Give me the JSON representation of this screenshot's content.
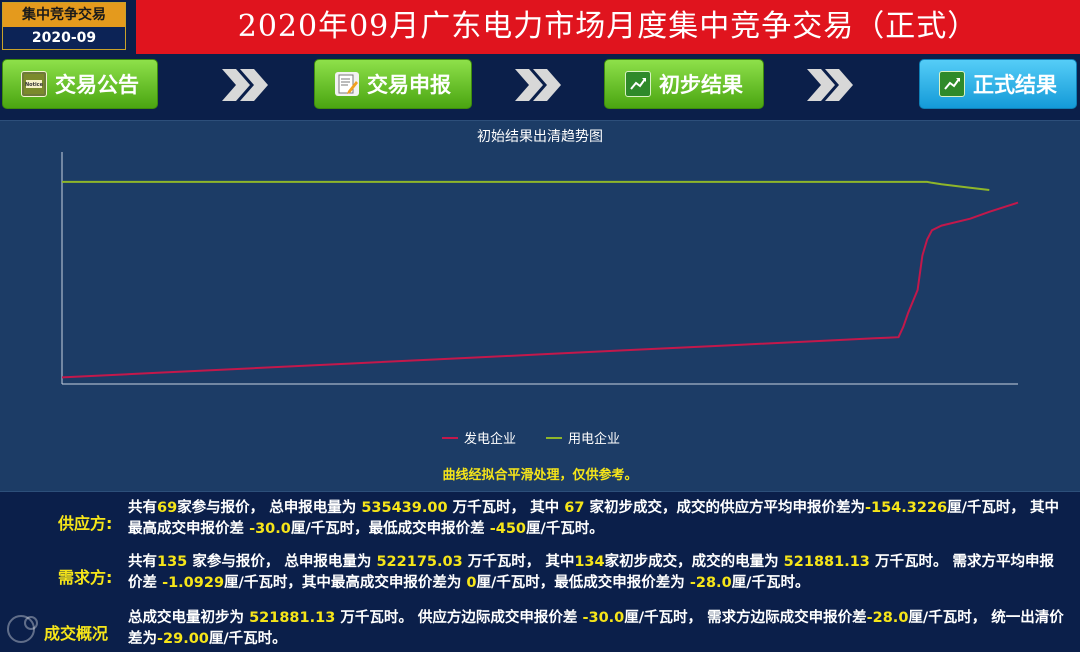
{
  "header": {
    "badge_label": "集中竞争交易",
    "badge_period": "2020-09",
    "title": "2020年09月广东电力市场月度集中竞争交易（正式）"
  },
  "nav": {
    "steps": [
      {
        "label": "交易公告",
        "icon": "notice-icon",
        "style": "green"
      },
      {
        "label": "交易申报",
        "icon": "edit-document-icon",
        "style": "green"
      },
      {
        "label": "初步结果",
        "icon": "result-icon",
        "style": "green"
      },
      {
        "label": "正式结果",
        "icon": "result-icon",
        "style": "blue"
      }
    ],
    "separator_icon": "double-chevron-right-icon"
  },
  "chart": {
    "title": "初始结果出清趋势图",
    "note": "曲线经拟合平滑处理，仅供参考。",
    "legend": [
      {
        "name": "发电企业",
        "color": "#c2184b"
      },
      {
        "name": "用电企业",
        "color": "#8fb62a"
      }
    ]
  },
  "chart_data": {
    "type": "line",
    "title": "初始结果出清趋势图",
    "xlabel": "",
    "ylabel": "",
    "grid": false,
    "legend_position": "bottom",
    "x": [
      0,
      10,
      20,
      30,
      40,
      50,
      60,
      70,
      80,
      85,
      87.5,
      88,
      88.5,
      89.5,
      90,
      90.5,
      91,
      92,
      95,
      97,
      100
    ],
    "series": [
      {
        "name": "发电企业",
        "color": "#c2184b",
        "values": [
          2,
          4,
          6,
          8,
          10,
          12,
          14,
          16,
          18,
          19,
          19.5,
          24,
          30,
          40,
          55,
          62,
          66,
          68,
          71,
          74,
          78
        ]
      },
      {
        "name": "用电企业",
        "color": "#8fb62a",
        "values": [
          87,
          87,
          87,
          87,
          87,
          87,
          87,
          87,
          87,
          87,
          87,
          87,
          87,
          87,
          87,
          87,
          86.6,
          86,
          84.5,
          83.5,
          null
        ]
      }
    ],
    "ylim": [
      0,
      100
    ],
    "xlim": [
      0,
      100
    ]
  },
  "summary": {
    "supply": {
      "label": "供应方:",
      "t1": "共有",
      "bidders": "69",
      "t2": "家参与报价，  总申报电量为",
      "total_volume": "535439.00",
      "t3": "万千瓦时，  其中",
      "matched": "67",
      "t4": "家初步成交，成交的供应方平均申报价差为",
      "avg_spread": "-154.3226",
      "t5": "厘/千瓦时，  其中最高成交申报价差",
      "max_spread": "-30.0",
      "t6": "厘/千瓦时，最低成交申报价差",
      "min_spread": "-450",
      "t7": "厘/千瓦时。"
    },
    "demand": {
      "label": "需求方:",
      "t1": "共有",
      "bidders": "135",
      "t2": "家参与报价，  总申报电量为",
      "total_volume": "522175.03",
      "t3": "万千瓦时，  其中",
      "matched": "134",
      "t4": "家初步成交，成交的电量为",
      "matched_volume": "521881.13",
      "t5": "万千瓦时。  需求方平均申报价差",
      "avg_spread": "-1.0929",
      "t6": "厘/千瓦时，其中最高成交申报价差为",
      "max_spread": "0",
      "t7": "厘/千瓦时，最低成交申报价差为",
      "min_spread": "-28.0",
      "t8": "厘/千瓦时。"
    },
    "overview": {
      "label": "成交概况",
      "t1": "总成交电量初步为",
      "total_volume": "521881.13",
      "t2": "万千瓦时。  供应方边际成交申报价差",
      "supply_margin": "-30.0",
      "t3": "厘/千瓦时，  需求方边际成交申报价差",
      "demand_margin": "-28.0",
      "t4": "厘/千瓦时，  统一出清价差为",
      "clearing_spread": "-29.00",
      "t5": "厘/千瓦时。"
    }
  }
}
